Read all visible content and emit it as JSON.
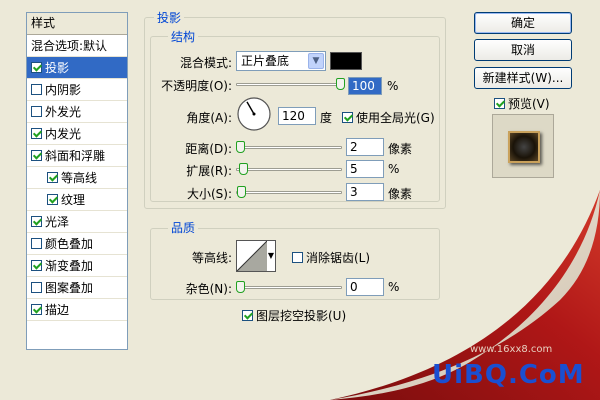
{
  "style_list": {
    "header": "样式",
    "items": [
      {
        "label": "混合选项:默认",
        "checkbox": false,
        "checked": false,
        "indent": false,
        "selected": false
      },
      {
        "label": "投影",
        "checkbox": true,
        "checked": true,
        "indent": false,
        "selected": true
      },
      {
        "label": "内阴影",
        "checkbox": true,
        "checked": false,
        "indent": false,
        "selected": false
      },
      {
        "label": "外发光",
        "checkbox": true,
        "checked": false,
        "indent": false,
        "selected": false
      },
      {
        "label": "内发光",
        "checkbox": true,
        "checked": true,
        "indent": false,
        "selected": false
      },
      {
        "label": "斜面和浮雕",
        "checkbox": true,
        "checked": true,
        "indent": false,
        "selected": false
      },
      {
        "label": "等高线",
        "checkbox": true,
        "checked": true,
        "indent": true,
        "selected": false
      },
      {
        "label": "纹理",
        "checkbox": true,
        "checked": true,
        "indent": true,
        "selected": false
      },
      {
        "label": "光泽",
        "checkbox": true,
        "checked": true,
        "indent": false,
        "selected": false
      },
      {
        "label": "颜色叠加",
        "checkbox": true,
        "checked": false,
        "indent": false,
        "selected": false
      },
      {
        "label": "渐变叠加",
        "checkbox": true,
        "checked": true,
        "indent": false,
        "selected": false
      },
      {
        "label": "图案叠加",
        "checkbox": true,
        "checked": false,
        "indent": false,
        "selected": false
      },
      {
        "label": "描边",
        "checkbox": true,
        "checked": true,
        "indent": false,
        "selected": false
      }
    ]
  },
  "drop_shadow": {
    "title": "投影",
    "structure": {
      "title": "结构",
      "blend_mode_label": "混合模式:",
      "blend_mode_value": "正片叠底",
      "blend_color": "#000000",
      "opacity_label": "不透明度(O):",
      "opacity_value": "100",
      "opacity_unit": "%",
      "opacity_fraction": 1.0,
      "angle_label": "角度(A):",
      "angle_value": "120",
      "angle_unit": "度",
      "global_light_label": "使用全局光(G)",
      "global_light_checked": true,
      "distance_label": "距离(D):",
      "distance_value": "2",
      "distance_unit": "像素",
      "spread_label": "扩展(R):",
      "spread_value": "5",
      "spread_unit": "%",
      "size_label": "大小(S):",
      "size_value": "3",
      "size_unit": "像素"
    },
    "quality": {
      "title": "品质",
      "contour_label": "等高线:",
      "antialias_label": "消除锯齿(L)",
      "antialias_checked": false,
      "noise_label": "杂色(N):",
      "noise_value": "0",
      "noise_unit": "%"
    },
    "knockout_label": "图层挖空投影(U)",
    "knockout_checked": true
  },
  "buttons": {
    "ok": "确定",
    "cancel": "取消",
    "new_style": "新建样式(W)...",
    "preview_label": "预览(V)",
    "preview_checked": true
  },
  "watermark": {
    "text": "UiBQ.CoM",
    "subtext": "www.16xx8.com"
  },
  "colors": {
    "accent": "#316ac5",
    "group_title": "#0046d5",
    "curl_red": "#b01717",
    "watermark_blue": "#1a4fd1"
  }
}
